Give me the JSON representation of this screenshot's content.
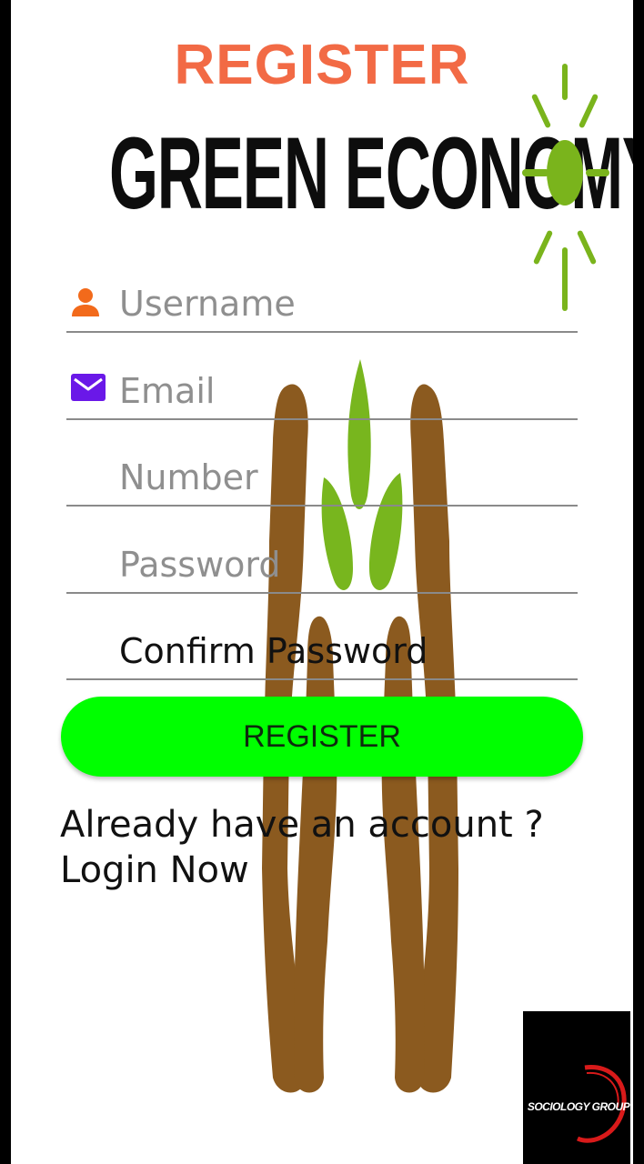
{
  "header": {
    "title": "REGISTER"
  },
  "brand": {
    "name": "GREEN ECONOMY"
  },
  "form": {
    "username_placeholder": "Username",
    "email_placeholder": "Email",
    "number_placeholder": "Number",
    "password_placeholder": "Password",
    "confirm_password_placeholder": "Confirm Password",
    "register_label": "REGISTER"
  },
  "footer": {
    "already_text": "Already have an account ?",
    "login_text": "Login Now"
  },
  "watermark": {
    "logo_text": "SOCIOLOGY GROUP"
  },
  "colors": {
    "title": "#f26a45",
    "register_button": "#00ff00",
    "username_icon": "#f26a1b",
    "email_icon": "#6a18e8",
    "sun": "#7ab41c",
    "hands": "#8b5a1f",
    "sprout": "#78b61e"
  },
  "icons": {
    "username": "person-icon",
    "email": "mail-icon"
  }
}
